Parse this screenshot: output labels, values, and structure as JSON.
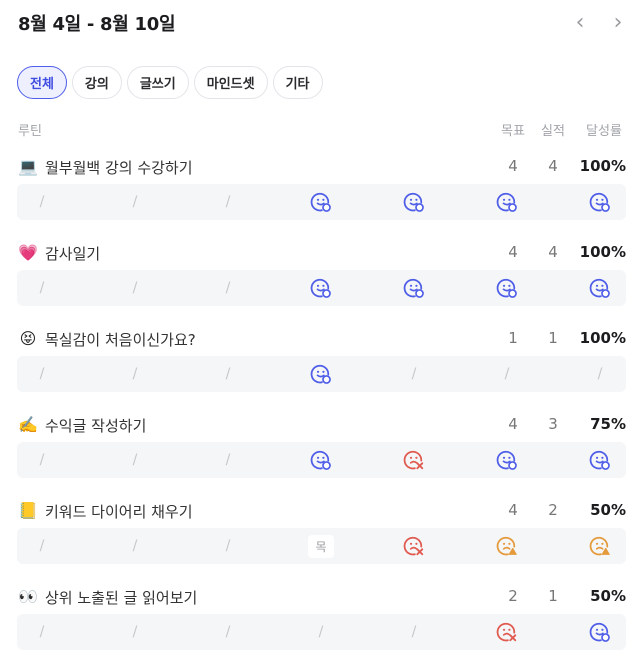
{
  "header": {
    "title": "8월 4일 - 8월 10일",
    "prev_label": "‹",
    "next_label": "›"
  },
  "filters": [
    {
      "label": "전체",
      "active": true
    },
    {
      "label": "강의",
      "active": false
    },
    {
      "label": "글쓰기",
      "active": false
    },
    {
      "label": "마인드셋",
      "active": false
    },
    {
      "label": "기타",
      "active": false
    }
  ],
  "columns": {
    "routine": "루틴",
    "goal": "목표",
    "actual": "실적",
    "rate": "달성률"
  },
  "status_colors": {
    "done": "#4f5ee8",
    "fail": "#e05a4f",
    "warn": "#e59a3c",
    "empty": "#c7c8cc"
  },
  "routines": [
    {
      "emoji": "💻",
      "name": "월부월백 강의 수강하기",
      "goal": "4",
      "actual": "4",
      "rate": "100%",
      "days": [
        {
          "type": "slash",
          "text": "/"
        },
        {
          "type": "slash",
          "text": "/"
        },
        {
          "type": "slash",
          "text": "/"
        },
        {
          "type": "done"
        },
        {
          "type": "done"
        },
        {
          "type": "done"
        },
        {
          "type": "done"
        }
      ]
    },
    {
      "emoji": "💗",
      "name": "감사일기",
      "goal": "4",
      "actual": "4",
      "rate": "100%",
      "days": [
        {
          "type": "slash",
          "text": "/"
        },
        {
          "type": "slash",
          "text": "/"
        },
        {
          "type": "slash",
          "text": "/"
        },
        {
          "type": "done"
        },
        {
          "type": "done"
        },
        {
          "type": "done"
        },
        {
          "type": "done"
        }
      ]
    },
    {
      "emoji": "😝",
      "name": "목실감이 처음이신가요?",
      "goal": "1",
      "actual": "1",
      "rate": "100%",
      "days": [
        {
          "type": "slash",
          "text": "/"
        },
        {
          "type": "slash",
          "text": "/"
        },
        {
          "type": "slash",
          "text": "/"
        },
        {
          "type": "done"
        },
        {
          "type": "slash",
          "text": "/"
        },
        {
          "type": "slash",
          "text": "/"
        },
        {
          "type": "slash",
          "text": "/"
        }
      ]
    },
    {
      "emoji": "✍️",
      "name": "수익글 작성하기",
      "goal": "4",
      "actual": "3",
      "rate": "75%",
      "days": [
        {
          "type": "slash",
          "text": "/"
        },
        {
          "type": "slash",
          "text": "/"
        },
        {
          "type": "slash",
          "text": "/"
        },
        {
          "type": "done"
        },
        {
          "type": "fail"
        },
        {
          "type": "done"
        },
        {
          "type": "done"
        }
      ]
    },
    {
      "emoji": "📒",
      "name": "키워드 다이어리 채우기",
      "goal": "4",
      "actual": "2",
      "rate": "50%",
      "days": [
        {
          "type": "slash",
          "text": "/"
        },
        {
          "type": "slash",
          "text": "/"
        },
        {
          "type": "slash",
          "text": "/"
        },
        {
          "type": "today",
          "text": "목"
        },
        {
          "type": "fail"
        },
        {
          "type": "warn"
        },
        {
          "type": "warn"
        }
      ]
    },
    {
      "emoji": "👀",
      "name": "상위 노출된 글 읽어보기",
      "goal": "2",
      "actual": "1",
      "rate": "50%",
      "days": [
        {
          "type": "slash",
          "text": "/"
        },
        {
          "type": "slash",
          "text": "/"
        },
        {
          "type": "slash",
          "text": "/"
        },
        {
          "type": "slash",
          "text": "/"
        },
        {
          "type": "slash",
          "text": "/"
        },
        {
          "type": "fail"
        },
        {
          "type": "done"
        }
      ]
    }
  ]
}
